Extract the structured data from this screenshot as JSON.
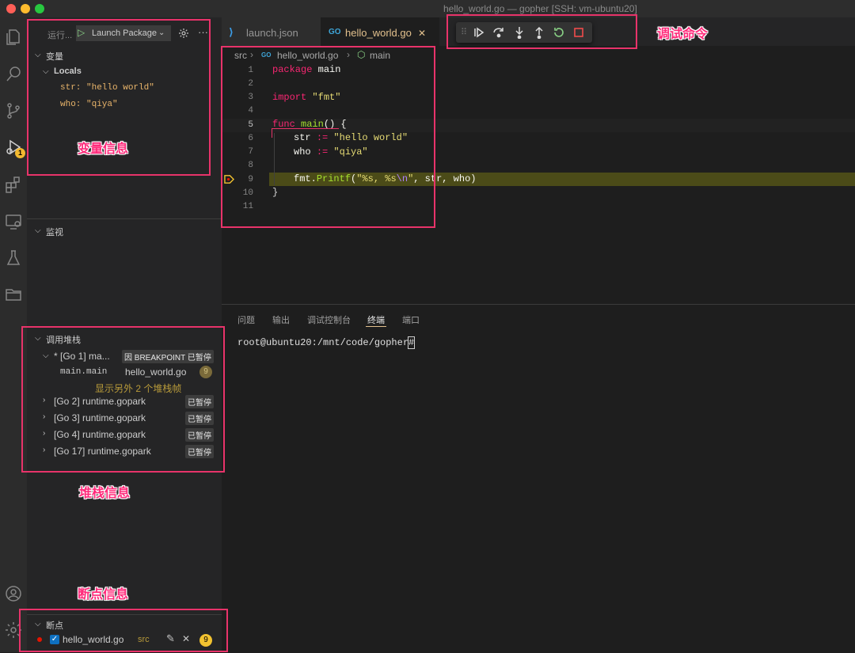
{
  "window": {
    "title": "hello_world.go — gopher [SSH: vm-ubuntu20]"
  },
  "activity_bar": {
    "debug_badge": "1"
  },
  "run": {
    "label": "运行...",
    "config": "Launch Package"
  },
  "variables": {
    "title": "变量",
    "locals_label": "Locals",
    "items": [
      "str: \"hello world\"",
      "who: \"qiya\""
    ]
  },
  "watch": {
    "title": "监视"
  },
  "callstack": {
    "title": "调用堆栈",
    "thread": {
      "label": "* [Go 1] ma...",
      "status": "因 BREAKPOINT 已暂停"
    },
    "frame": {
      "name": "main.main",
      "file": "hello_world.go",
      "line": "9"
    },
    "more_frames": "显示另外 2 个堆栈帧",
    "others": [
      {
        "label": "[Go 2] runtime.gopark",
        "status": "已暂停"
      },
      {
        "label": "[Go 3] runtime.gopark",
        "status": "已暂停"
      },
      {
        "label": "[Go 4] runtime.gopark",
        "status": "已暂停"
      },
      {
        "label": "[Go 17] runtime.gopark",
        "status": "已暂停"
      }
    ]
  },
  "breakpoints": {
    "title": "断点",
    "item": {
      "file": "hello_world.go",
      "dir": "src",
      "line": "9"
    }
  },
  "tabs": [
    {
      "label": "launch.json"
    },
    {
      "label": "hello_world.go"
    }
  ],
  "breadcrumb": {
    "folder": "src",
    "file": "hello_world.go",
    "symbol": "main"
  },
  "editor": {
    "line_numbers": [
      "1",
      "2",
      "3",
      "4",
      "5",
      "6",
      "7",
      "8",
      "9",
      "10",
      "11"
    ],
    "current_line": 9,
    "code": {
      "l1_kw": "package",
      "l1_rest": " main",
      "l3_kw": "import",
      "l3_str": "\"fmt\"",
      "l5_kw": "func",
      "l5_fn": "main",
      "l5_rest": "() {",
      "l6_id": "str",
      "l6_op": ":=",
      "l6_str": "\"hello world\"",
      "l7_id": "who",
      "l7_op": ":=",
      "l7_str": "\"qiya\"",
      "l9_pkg": "fmt.",
      "l9_fn": "Printf",
      "l9_p": "(",
      "l9_s1": "\"%s, %s",
      "l9_esc": "\\n",
      "l9_s2": "\"",
      "l9_rest": ", str, who)",
      "l10": "}"
    }
  },
  "panel": {
    "tabs": [
      "问题",
      "输出",
      "调试控制台",
      "终端",
      "端口"
    ],
    "active_tab": "终端",
    "terminal_line": "root@ubuntu20:/mnt/code/gopher#"
  },
  "annotations": {
    "debug_commands": "调试命令",
    "variable_info": "变量信息",
    "stack_info": "堆栈信息",
    "breakpoint_info": "断点信息"
  },
  "colors": {
    "accent": "#e8336a",
    "badge": "#f2b930",
    "breakpoint": "#e51400",
    "current_line": "#4b4b18"
  }
}
